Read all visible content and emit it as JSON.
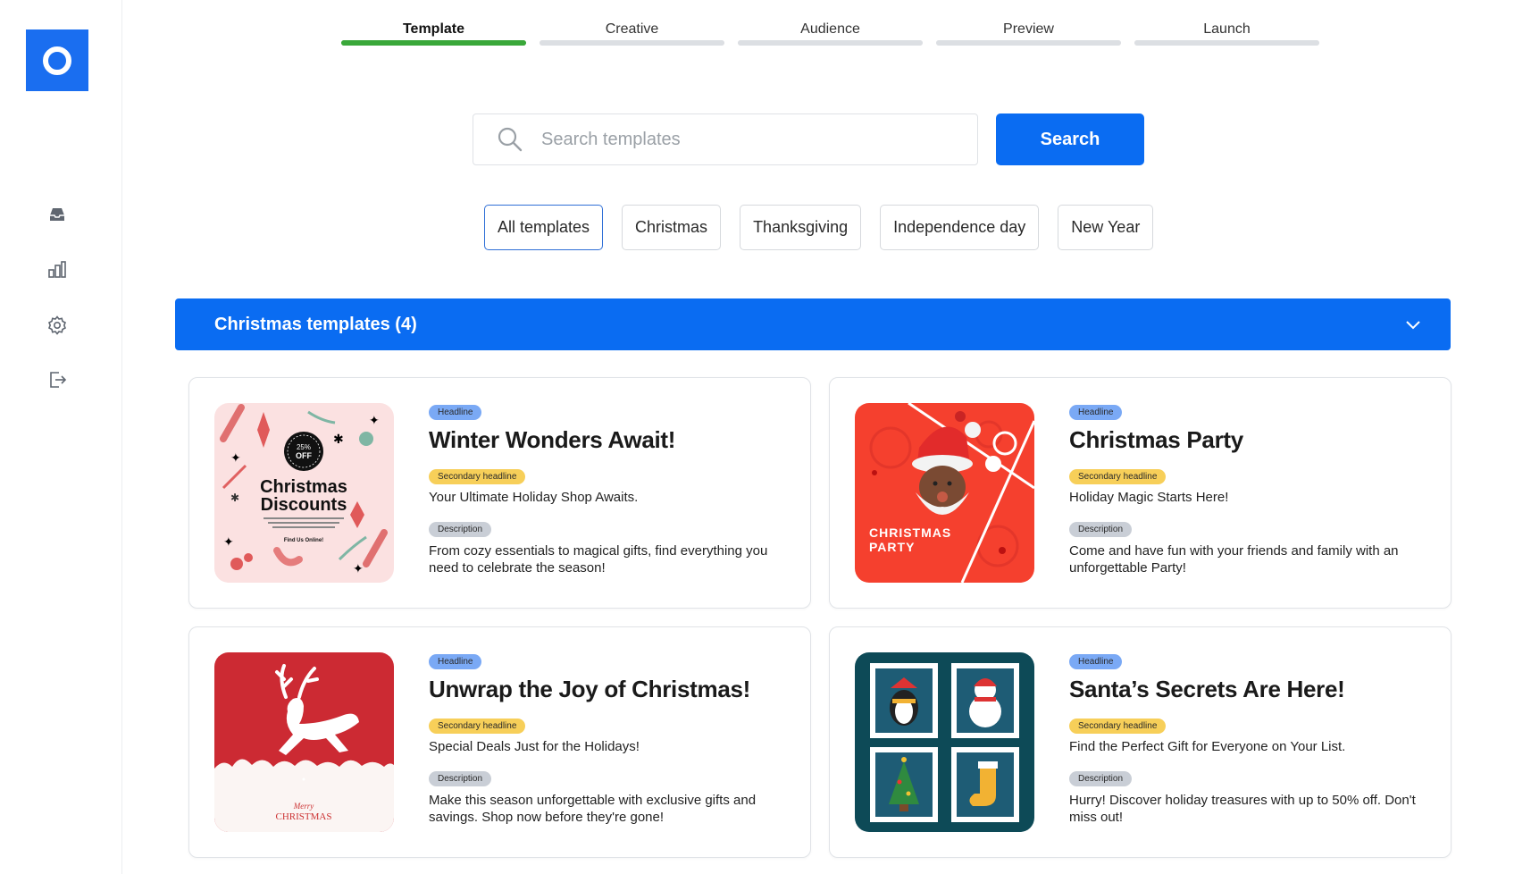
{
  "steps": [
    {
      "label": "Template",
      "active": true
    },
    {
      "label": "Creative",
      "active": false
    },
    {
      "label": "Audience",
      "active": false
    },
    {
      "label": "Preview",
      "active": false
    },
    {
      "label": "Launch",
      "active": false
    }
  ],
  "search": {
    "placeholder": "Search templates",
    "value": "",
    "button_label": "Search"
  },
  "filters": [
    "All templates",
    "Christmas",
    "Thanksgiving",
    "Independence day",
    "New Year"
  ],
  "active_filter": "All templates",
  "section": {
    "title": "Christmas templates (4)"
  },
  "tags": {
    "headline": "Headline",
    "secondary": "Secondary headline",
    "description": "Description"
  },
  "cards": [
    {
      "headline": "Winter Wonders Await!",
      "secondary": "Your Ultimate Holiday Shop Awaits.",
      "description": "From cozy essentials to magical gifts, find everything you need to celebrate the season!",
      "thumb": {
        "line1": "Christmas",
        "line2": "Discounts",
        "badge_pct": "25%",
        "badge_off": "OFF",
        "footer": "Find Us Online!"
      }
    },
    {
      "headline": "Christmas Party",
      "secondary": "Holiday Magic Starts Here!",
      "description": "Come and have fun with your friends and family with an unforgettable Party!",
      "thumb": {
        "line1": "CHRISTMAS",
        "line2": "PARTY"
      }
    },
    {
      "headline": "Unwrap the Joy of Christmas!",
      "secondary": "Special Deals Just for the Holidays!",
      "description": "Make this season unforgettable with exclusive gifts and savings. Shop now before they're gone!",
      "thumb": {
        "line1": "Merry",
        "line2": "CHRISTMAS"
      }
    },
    {
      "headline": "Santa’s Secrets Are Here!",
      "secondary": "Find the Perfect Gift for Everyone on Your List.",
      "description": "Hurry! Discover holiday treasures with up to 50% off. Don't miss out!",
      "thumb": {}
    }
  ],
  "colors": {
    "accent": "#0a6cf2",
    "progress_active": "#3aa83a",
    "tag_headline": "#7aa9f5",
    "tag_secondary": "#f7cf59",
    "tag_description": "#c9ced6"
  }
}
